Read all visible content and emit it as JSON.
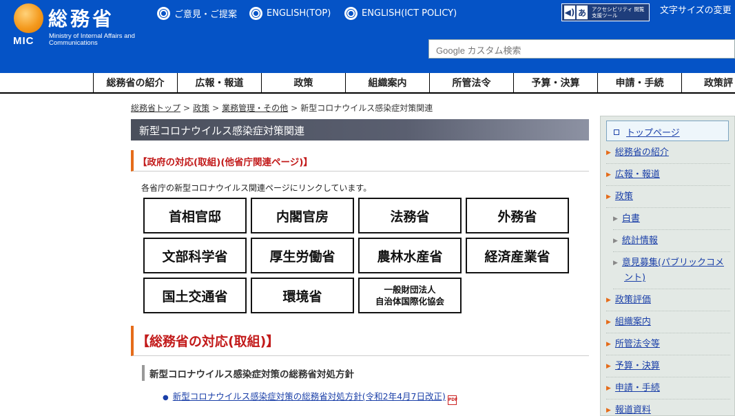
{
  "header": {
    "logo_text_jp": "総務省",
    "logo_text_abbr": "MIC",
    "logo_text_en": "Ministry of Internal Affairs and Communications",
    "top_links": [
      "ご意見・ご提案",
      "ENGLISH(TOP)",
      "ENGLISH(ICT POLICY)"
    ],
    "accessibility_label": "アクセシビリティ 閲覧支援ツール",
    "font_size_label": "文字サイズの変更",
    "search_placeholder": "Google カスタム検索"
  },
  "global_nav": [
    "総務省の紹介",
    "広報・報道",
    "政策",
    "組織案内",
    "所管法令",
    "予算・決算",
    "申請・手続",
    "政策評"
  ],
  "breadcrumb": {
    "items": [
      "総務省トップ",
      "政策",
      "業務管理・その他"
    ],
    "current": "新型コロナウイルス感染症対策関連",
    "separator": ">"
  },
  "main": {
    "page_title": "新型コロナウイルス感染症対策関連",
    "section1_heading": "【政府の対応(取組)(他省庁関連ページ)】",
    "intro_text": "各省庁の新型コロナウイルス関連ページにリンクしています。",
    "ministries": [
      "首相官邸",
      "内閣官房",
      "法務省",
      "外務省",
      "文部科学省",
      "厚生労働省",
      "農林水産省",
      "経済産業省",
      "国土交通省",
      "環境省",
      "一般財団法人\n自治体国際化協会"
    ],
    "section2_heading": "【総務省の対応(取組)】",
    "subsection_heading": "新型コロナウイルス感染症対策の総務省対処方針",
    "doc_link": "新型コロナウイルス感染症対策の総務省対処方針(令和2年4月7日改正)",
    "pdf_icon_label": "PDF"
  },
  "side_nav": {
    "top_label": "トップページ",
    "items": [
      {
        "label": "総務省の紹介",
        "sub": false
      },
      {
        "label": "広報・報道",
        "sub": false
      },
      {
        "label": "政策",
        "sub": false
      },
      {
        "label": "白書",
        "sub": true
      },
      {
        "label": "統計情報",
        "sub": true
      },
      {
        "label": "意見募集(パブリックコメント)",
        "sub": true
      },
      {
        "label": "政策評価",
        "sub": false
      },
      {
        "label": "組織案内",
        "sub": false
      },
      {
        "label": "所管法令等",
        "sub": false
      },
      {
        "label": "予算・決算",
        "sub": false
      },
      {
        "label": "申請・手続",
        "sub": false
      },
      {
        "label": "報道資料",
        "sub": false
      }
    ]
  },
  "colors": {
    "header_blue": "#0553c6",
    "accent_orange": "#e56c1a",
    "heading_red": "#c21a1a",
    "link_blue": "#1a3fa8",
    "side_bg": "#e3e9e5"
  }
}
